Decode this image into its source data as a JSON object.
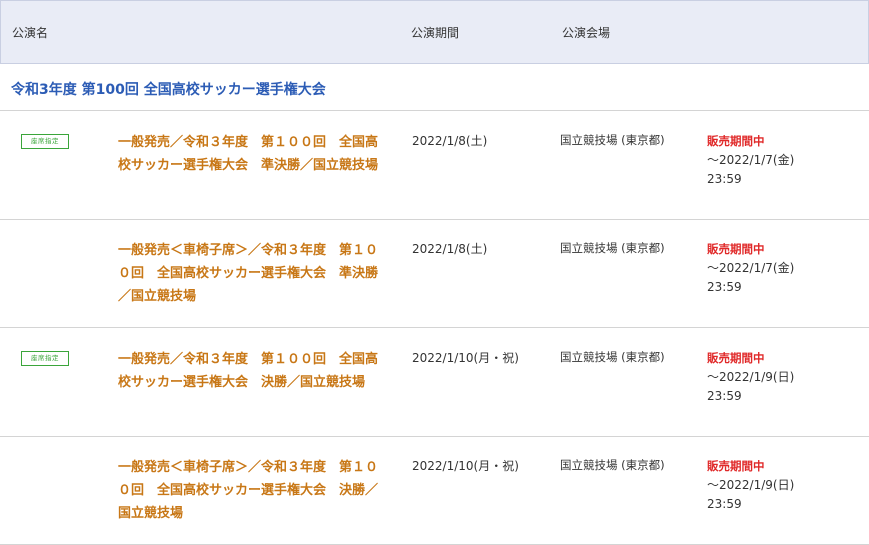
{
  "header": {
    "col_name": "公演名",
    "col_period": "公演期間",
    "col_venue": "公演会場"
  },
  "group": {
    "title": "令和3年度 第100回 全国高校サッカー選手権大会"
  },
  "rows": [
    {
      "badge": "座席指定",
      "title": "一般発売／令和３年度　第１００回　全国高校サッカー選手権大会　準決勝／国立競技場",
      "date": "2022/1/8(土)",
      "venue": "国立競技場 (東京都)",
      "status": "販売期間中",
      "until": "～2022/1/7(金)",
      "time": "23:59"
    },
    {
      "badge": "",
      "title": "一般発売＜車椅子席＞／令和３年度　第１００回　全国高校サッカー選手権大会　準決勝／国立競技場",
      "date": "2022/1/8(土)",
      "venue": "国立競技場 (東京都)",
      "status": "販売期間中",
      "until": "～2022/1/7(金)",
      "time": "23:59"
    },
    {
      "badge": "座席指定",
      "title": "一般発売／令和３年度　第１００回　全国高校サッカー選手権大会　決勝／国立競技場",
      "date": "2022/1/10(月・祝)",
      "venue": "国立競技場 (東京都)",
      "status": "販売期間中",
      "until": "～2022/1/9(日)",
      "time": "23:59"
    },
    {
      "badge": "",
      "title": "一般発売＜車椅子席＞／令和３年度　第１００回　全国高校サッカー選手権大会　決勝／国立競技場",
      "date": "2022/1/10(月・祝)",
      "venue": "国立競技場 (東京都)",
      "status": "販売期間中",
      "until": "～2022/1/9(日)",
      "time": "23:59"
    }
  ]
}
